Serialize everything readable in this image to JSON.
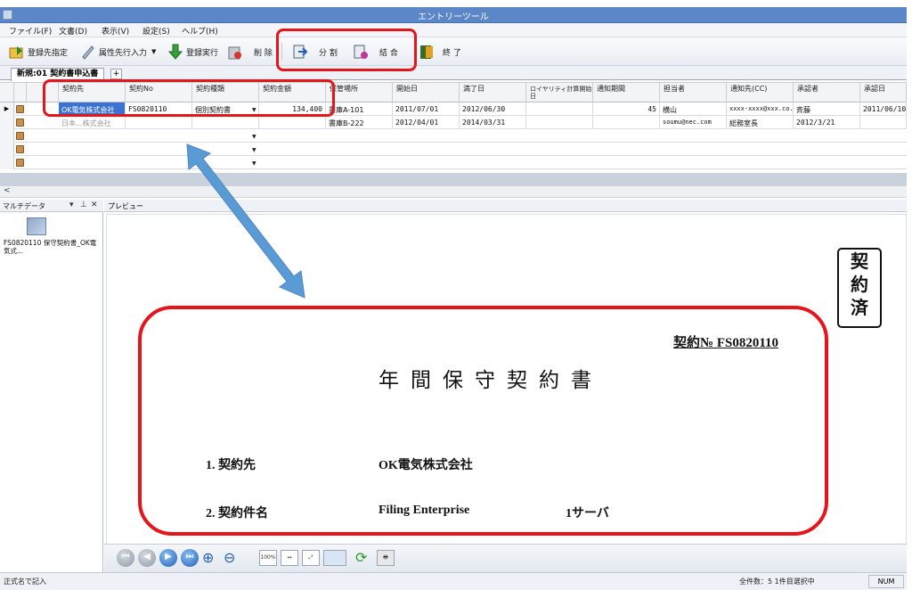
{
  "window": {
    "title": "エントリーツール"
  },
  "menu": [
    "ファイル(F)",
    "文書(D)",
    "表示(V)",
    "設定(S)",
    "ヘルプ(H)"
  ],
  "toolbar": {
    "register_dest": "登録先指定",
    "attr_input": "属性先行入力",
    "register_exec": "登録実行",
    "delete": "削 除",
    "split": "分 割",
    "merge": "結 合",
    "finish": "終 了"
  },
  "tab": {
    "label": "新規:01 契約書申込書",
    "add": "+"
  },
  "grid": {
    "columns": [
      "契約先",
      "契約No",
      "契約種類",
      "契約金額",
      "保管場所",
      "開始日",
      "満了日",
      "ロイヤリティ計算開始日",
      "通知期間",
      "担当者",
      "通知先(CC)",
      "承認者",
      "承認日"
    ],
    "rows": [
      [
        "OK電気株式会社",
        "FS0820110",
        "個別契約書",
        "134,400",
        "書庫A-101",
        "2011/07/01",
        "2012/06/30",
        "",
        "45",
        "横山",
        "xxxx-xxxx@xxx.co.jp",
        "斉藤",
        "2011/06/10"
      ],
      [
        "日本...株式会社",
        "",
        "",
        "",
        "書庫B-222",
        "2012/04/01",
        "2014/03/31",
        "",
        "",
        "soumu@nec.com",
        "総務室長",
        "2012/3/21",
        ""
      ],
      [
        "",
        "",
        "",
        "",
        "",
        "",
        "",
        "",
        "",
        "",
        "",
        "",
        ""
      ],
      [
        "",
        "",
        "",
        "",
        "",
        "",
        "",
        "",
        "",
        "",
        "",
        "",
        ""
      ],
      [
        "",
        "",
        "",
        "",
        "",
        "",
        "",
        "",
        "",
        "",
        "",
        "",
        ""
      ]
    ]
  },
  "left_pane": {
    "title": "マルチデータ",
    "thumb_label": "FS0820110 保守契約書_OK電気式..."
  },
  "preview": {
    "title": "プレビュー",
    "stamp": [
      "契",
      "約",
      "済"
    ],
    "doc_no": "契約№ FS0820110",
    "doc_title": "年間保守契約書",
    "line1_label": "1. 契約先",
    "line1_value": "OK電気株式会社",
    "line2_label": "2. 契約件名",
    "line2_value": "Filing Enterprise",
    "line2_extra": "1サーバ",
    "zoom_label": "100%"
  },
  "status": {
    "left": "正式名で記入",
    "count": "全件数：5  1件目選択中",
    "num": "NUM"
  },
  "colors": {
    "highlight": "#e5161b",
    "arrow": "#5b9bd5",
    "titlebar": "#5b87c9"
  }
}
